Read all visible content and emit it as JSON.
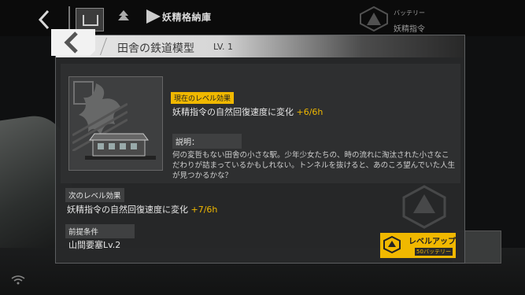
{
  "topbar": {
    "back_icon": "chevron-left-icon",
    "home_icon": "home-icon",
    "tree_icon": "tree-icon",
    "section_icon": "arrow-right-icon",
    "section_title": "妖精格納庫",
    "resource_label": "バッテリー",
    "resource_value": "",
    "resource2_label": "妖精指令",
    "resource2_value": ""
  },
  "panel": {
    "back_icon": "chevron-left-icon",
    "title": "田舎の鉄道模型",
    "level": "LV. 1",
    "current_effect_tag": "現在のレベル効果",
    "current_effect_text": "妖精指令の自然回復速度に変化",
    "current_effect_value": "+6/6h",
    "description_tag": "説明：",
    "description_text": "何の変哲もない田舎の小さな駅。少年少女たちの、時の流れに淘汰された小さなこだわりが詰まっているかもしれない。トンネルを抜けると、あのころ望んでいた人生が見つかるかな？",
    "next_effect_tag": "次のレベル効果",
    "next_effect_text": "妖精指令の自然回復速度に変化",
    "next_effect_value": "+7/6h",
    "prereq_tag": "前提条件",
    "prereq_value": "山間要塞Lv.2",
    "levelup_label": "レベルアップ",
    "levelup_cost": "50バッテリー"
  },
  "colors": {
    "accent": "#f0b800",
    "panel_bg": "#28292a",
    "text": "#e6e6e6"
  }
}
